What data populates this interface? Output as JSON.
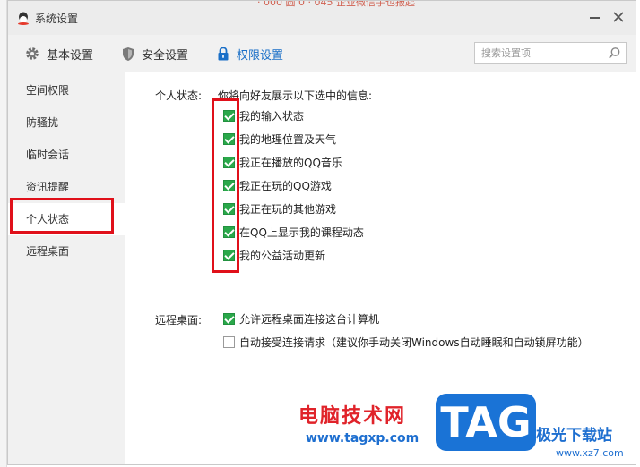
{
  "window": {
    "title": "系统设置",
    "background_notice": "· 000 圆 0 · 045 企业微信手也报起"
  },
  "toolbar": {
    "tabs": [
      {
        "label": "基本设置",
        "icon": "gear-icon",
        "active": false
      },
      {
        "label": "安全设置",
        "icon": "shield-icon",
        "active": false
      },
      {
        "label": "权限设置",
        "icon": "lock-icon",
        "active": true
      }
    ],
    "search_placeholder": "搜索设置项"
  },
  "sidebar": {
    "items": [
      {
        "label": "空间权限",
        "active": false
      },
      {
        "label": "防骚扰",
        "active": false
      },
      {
        "label": "临时会话",
        "active": false
      },
      {
        "label": "资讯提醒",
        "active": false
      },
      {
        "label": "个人状态",
        "active": true
      },
      {
        "label": "远程桌面",
        "active": false
      }
    ]
  },
  "personal_status": {
    "label": "个人状态:",
    "intro": "你将向好友展示以下选中的信息:",
    "options": [
      {
        "label": "我的输入状态",
        "checked": true
      },
      {
        "label": "我的地理位置及天气",
        "checked": true
      },
      {
        "label": "我正在播放的QQ音乐",
        "checked": true
      },
      {
        "label": "我正在玩的QQ游戏",
        "checked": true
      },
      {
        "label": "我正在玩的其他游戏",
        "checked": true
      },
      {
        "label": "在QQ上显示我的课程动态",
        "checked": true
      },
      {
        "label": "我的公益活动更新",
        "checked": true
      }
    ]
  },
  "remote_desktop": {
    "label": "远程桌面:",
    "options": [
      {
        "label": "允许远程桌面连接这台计算机",
        "checked": true
      },
      {
        "label": "自动接受连接请求（建议你手动关闭Windows自动睡眠和自动锁屏功能）",
        "checked": false
      }
    ]
  },
  "watermark": {
    "cn_text": "电脑技术网",
    "url": "www.tagxp.com",
    "tag": "TAG",
    "site": "极光下载站",
    "site_url": "www.xz7.com"
  },
  "colors": {
    "accent": "#1a6fc7",
    "check_green": "#2aa84a",
    "highlight_red": "#e0101a",
    "toolbar_bg": "#f1f1f1"
  }
}
